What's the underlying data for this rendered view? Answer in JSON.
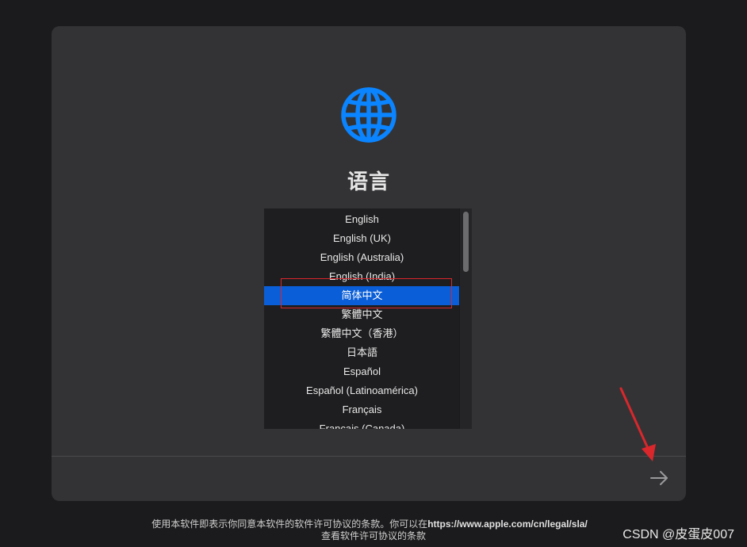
{
  "header": {
    "title": "语言",
    "icon": "globe-icon",
    "icon_color": "#0a84ff"
  },
  "languages": {
    "selected_index": 4,
    "selected_color": "#0a5ed7",
    "items": [
      {
        "label": "English"
      },
      {
        "label": "English (UK)"
      },
      {
        "label": "English (Australia)"
      },
      {
        "label": "English (India)"
      },
      {
        "label": "简体中文"
      },
      {
        "label": "繁體中文"
      },
      {
        "label": "繁體中文（香港）"
      },
      {
        "label": "日本語"
      },
      {
        "label": "Español"
      },
      {
        "label": "Español (Latinoamérica)"
      },
      {
        "label": "Français"
      },
      {
        "label": "Français (Canada)"
      }
    ]
  },
  "navigation": {
    "next_icon": "arrow-right-icon"
  },
  "annotation": {
    "color": "#d9272c"
  },
  "footer": {
    "license_text": "使用本软件即表示你同意本软件的软件许可协议的条款。你可以在",
    "license_url": "https://www.apple.com/cn/legal/sla/",
    "view_license_text": "查看软件许可协议的条款"
  },
  "watermark": "CSDN @皮蛋皮007"
}
